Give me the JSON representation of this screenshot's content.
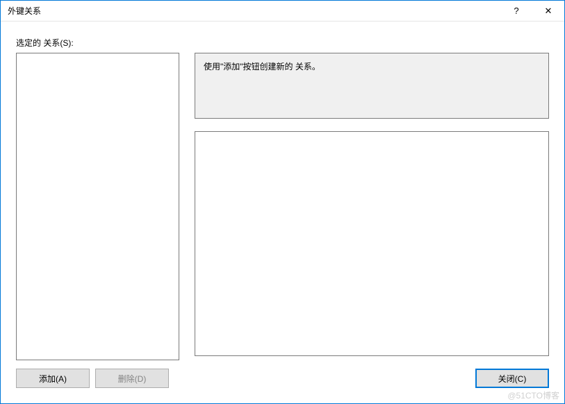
{
  "titlebar": {
    "title": "外键关系",
    "help_symbol": "?",
    "close_symbol": "✕"
  },
  "labels": {
    "selected_relation": "选定的 关系(S):"
  },
  "info": {
    "message": "使用\"添加\"按钮创建新的 关系。"
  },
  "buttons": {
    "add": "添加(A)",
    "delete": "删除(D)",
    "close": "关闭(C)"
  },
  "watermark": "@51CTO博客"
}
